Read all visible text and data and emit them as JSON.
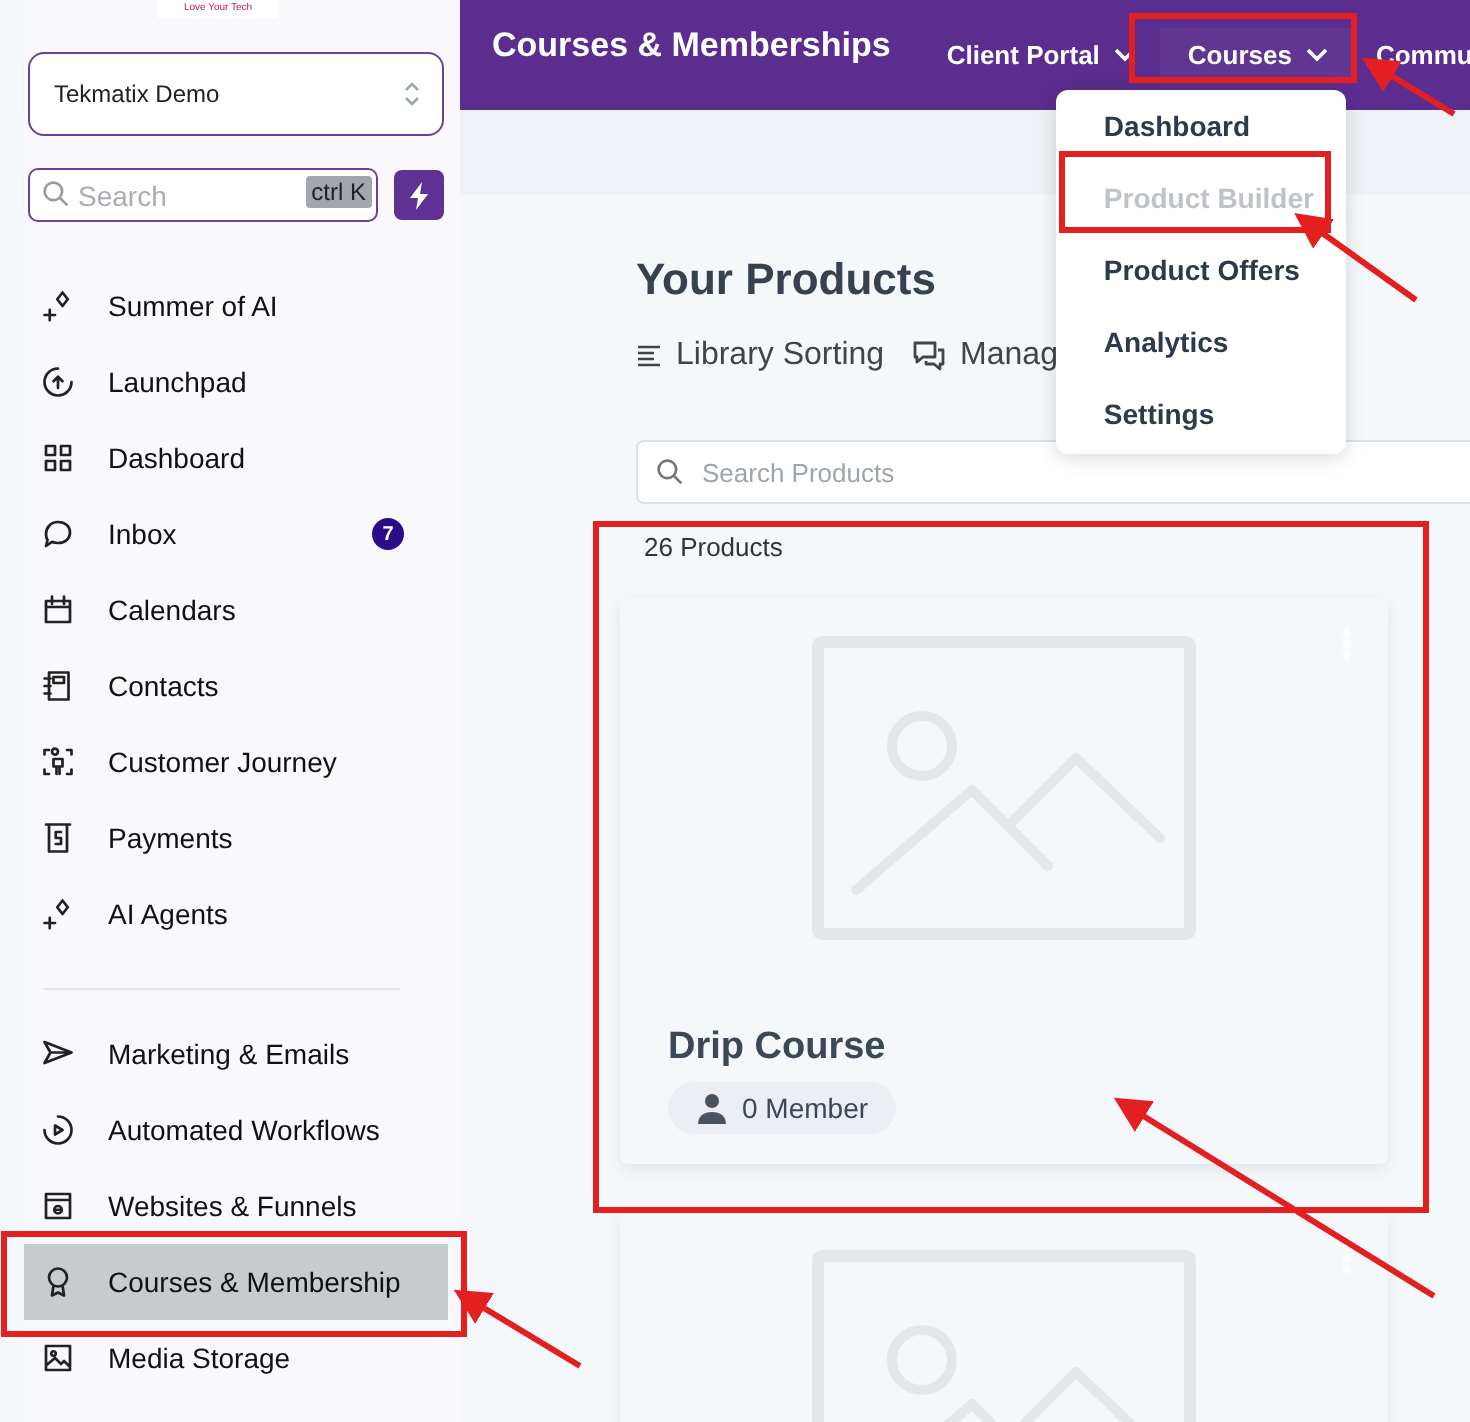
{
  "logo": {
    "tagline": "Love Your Tech"
  },
  "account": {
    "name": "Tekmatix Demo"
  },
  "sidebar_search": {
    "placeholder": "Search",
    "shortcut": "ctrl K"
  },
  "sidebar": {
    "sections": [
      {
        "items": [
          {
            "label": "Summer of AI",
            "selected": false
          },
          {
            "label": "Launchpad",
            "selected": false
          },
          {
            "label": "Dashboard",
            "selected": false
          },
          {
            "label": "Inbox",
            "selected": false,
            "badge": "7"
          },
          {
            "label": "Calendars",
            "selected": false
          },
          {
            "label": "Contacts",
            "selected": false
          },
          {
            "label": "Customer Journey",
            "selected": false
          },
          {
            "label": "Payments",
            "selected": false
          },
          {
            "label": "AI Agents",
            "selected": false
          }
        ]
      },
      {
        "items": [
          {
            "label": "Marketing & Emails",
            "selected": false
          },
          {
            "label": "Automated Workflows",
            "selected": false
          },
          {
            "label": "Websites & Funnels",
            "selected": false
          },
          {
            "label": "Courses & Membership",
            "selected": true
          },
          {
            "label": "Media Storage",
            "selected": false
          }
        ]
      }
    ]
  },
  "header": {
    "title": "Courses & Memberships",
    "nav": [
      {
        "label": "Client Portal"
      },
      {
        "label": "Courses",
        "expanded": true,
        "menu": [
          {
            "label": "Dashboard",
            "disabled": false
          },
          {
            "label": "Product Builder",
            "disabled": true
          },
          {
            "label": "Product Offers",
            "disabled": false
          },
          {
            "label": "Analytics",
            "disabled": false
          },
          {
            "label": "Settings",
            "disabled": false
          }
        ]
      },
      {
        "label": "Commu"
      }
    ]
  },
  "page": {
    "title": "Your Products",
    "actions": [
      {
        "label": "Library Sorting"
      },
      {
        "label": "Manag"
      }
    ],
    "search": {
      "placeholder": "Search Products"
    },
    "count": "26 Products",
    "products": [
      {
        "kind": "no-image",
        "title": "Drip Course",
        "members": "0 Member"
      },
      {
        "kind": "no-image"
      }
    ]
  }
}
